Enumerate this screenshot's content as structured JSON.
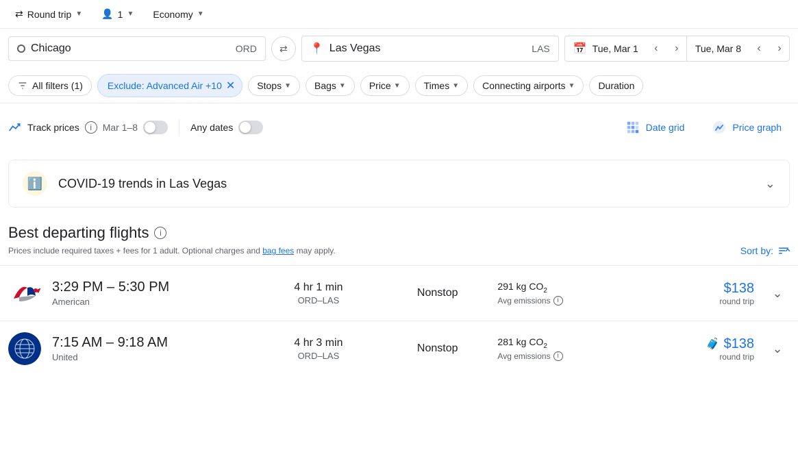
{
  "topbar": {
    "round_trip_label": "Round trip",
    "passengers_label": "1",
    "cabin_label": "Economy"
  },
  "search": {
    "origin_value": "Chicago",
    "origin_code": "ORD",
    "destination_value": "Las Vegas",
    "destination_code": "LAS",
    "depart_date": "Tue, Mar 1",
    "return_date": "Tue, Mar 8",
    "swap_icon": "⇌",
    "calendar_icon": "📅"
  },
  "filters": {
    "all_filters_label": "All filters (1)",
    "exclude_chip_label": "Exclude: Advanced Air +10",
    "stops_label": "Stops",
    "bags_label": "Bags",
    "price_label": "Price",
    "times_label": "Times",
    "connecting_airports_label": "Connecting airports",
    "duration_label": "Duration"
  },
  "track": {
    "label": "Track prices",
    "dates": "Mar 1–8",
    "any_dates_label": "Any dates",
    "date_grid_label": "Date grid",
    "price_graph_label": "Price graph"
  },
  "covid": {
    "title": "COVID-19 trends in Las Vegas"
  },
  "best_flights": {
    "title": "Best departing flights",
    "subtitle": "Prices include required taxes + fees for 1 adult. Optional charges and ",
    "bag_fees_link": "bag fees",
    "subtitle2": " may apply.",
    "sort_by_label": "Sort by:"
  },
  "flights": [
    {
      "id": 1,
      "time_range": "3:29 PM – 5:30 PM",
      "airline": "American",
      "duration": "4 hr 1 min",
      "route": "ORD–LAS",
      "stops": "Nonstop",
      "emissions": "291 kg CO₂",
      "emissions_label": "Avg emissions",
      "price": "$138",
      "price_sub": "round trip",
      "has_luggage_warning": false
    },
    {
      "id": 2,
      "time_range": "7:15 AM – 9:18 AM",
      "airline": "United",
      "duration": "4 hr 3 min",
      "route": "ORD–LAS",
      "stops": "Nonstop",
      "emissions": "281 kg CO₂",
      "emissions_label": "Avg emissions",
      "price": "$138",
      "price_sub": "round trip",
      "has_luggage_warning": true
    }
  ]
}
